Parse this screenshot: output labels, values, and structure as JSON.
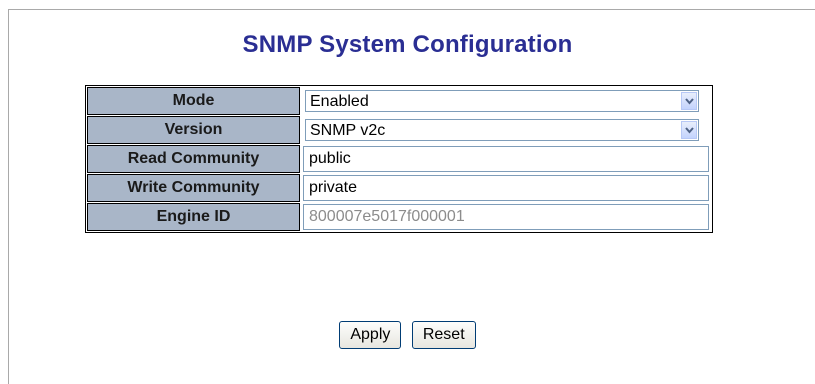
{
  "page": {
    "title": "SNMP System Configuration"
  },
  "form": {
    "mode": {
      "label": "Mode",
      "value": "Enabled"
    },
    "version": {
      "label": "Version",
      "value": "SNMP v2c"
    },
    "read_community": {
      "label": "Read Community",
      "value": "public"
    },
    "write_community": {
      "label": "Write Community",
      "value": "private"
    },
    "engine_id": {
      "label": "Engine ID",
      "value": "800007e5017f000001"
    }
  },
  "buttons": {
    "apply_label": "Apply",
    "reset_label": "Reset"
  },
  "icons": {
    "dropdown": "chevron-down-icon"
  },
  "colors": {
    "title": "#2a2e93",
    "label_bg": "#a9b6c8",
    "disabled_text": "#8c8c8c"
  }
}
